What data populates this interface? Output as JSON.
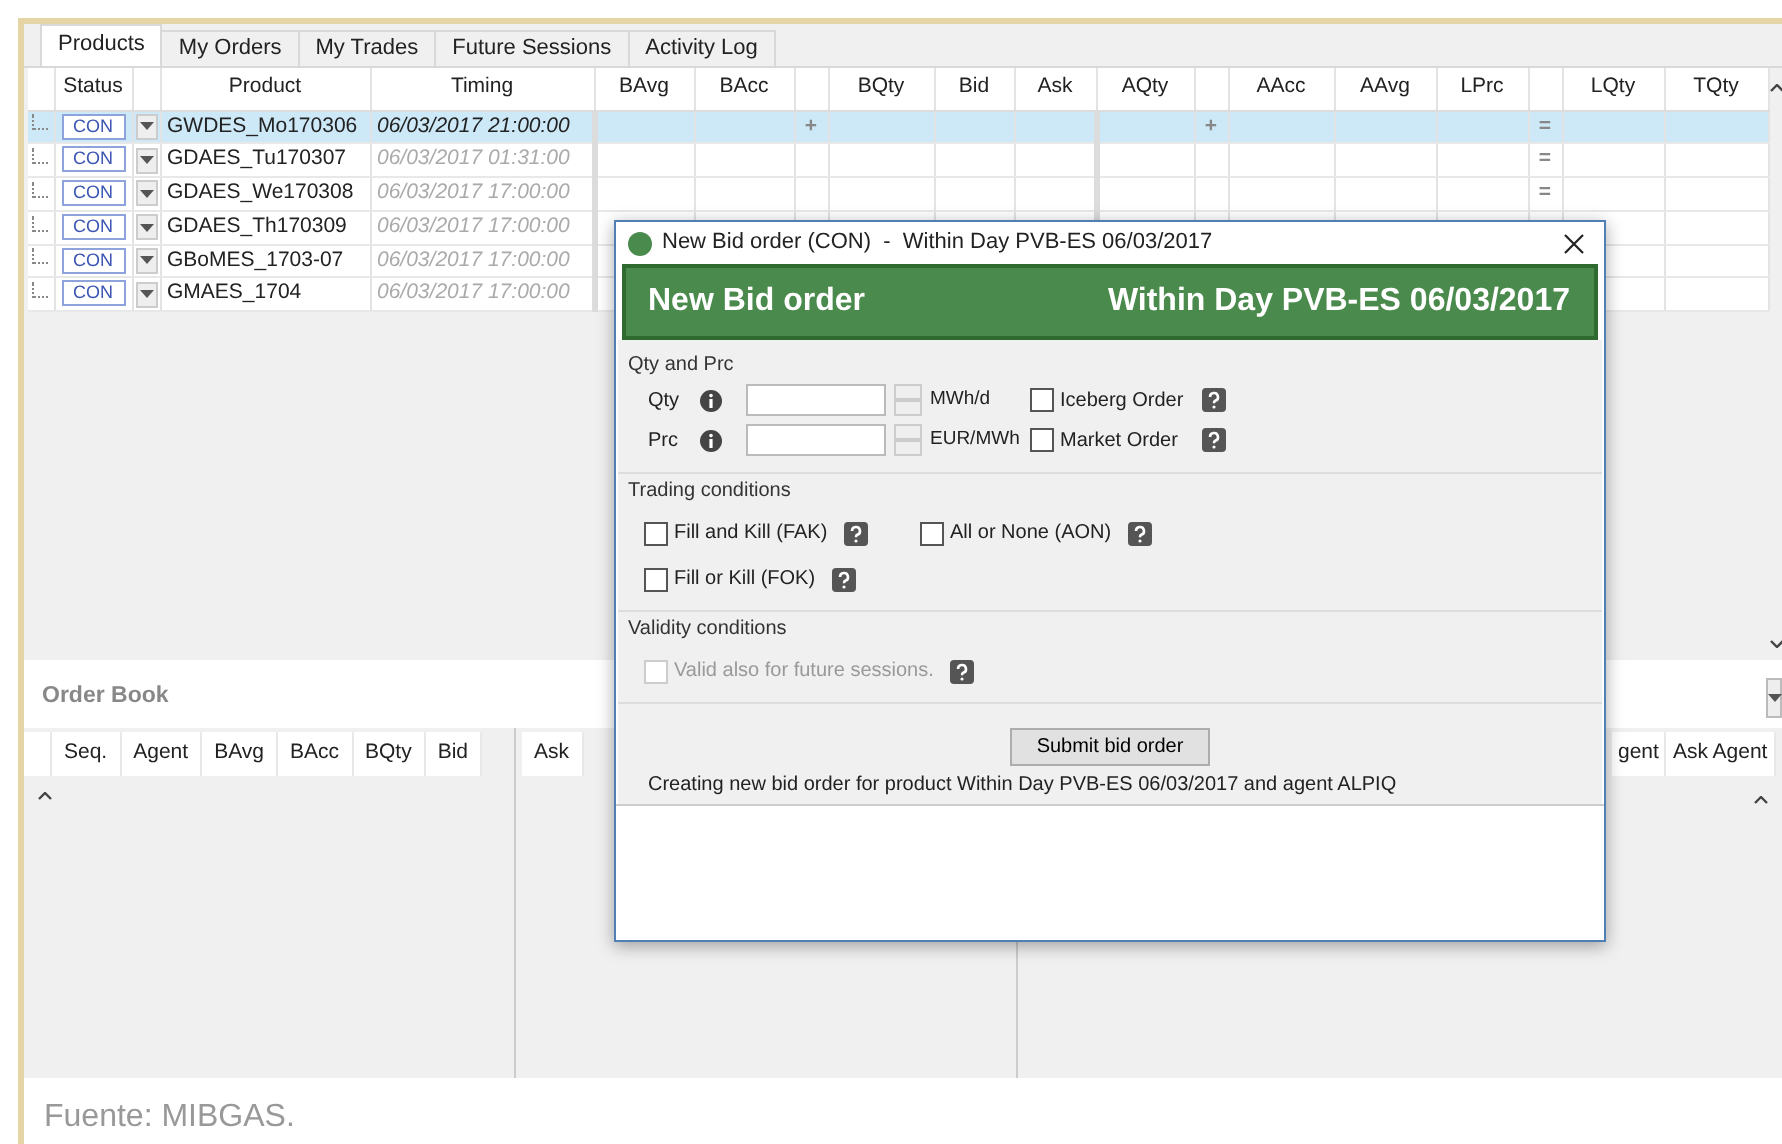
{
  "tabs": [
    {
      "label": "Products",
      "selected": true
    },
    {
      "label": "My Orders",
      "selected": false
    },
    {
      "label": "My Trades",
      "selected": false
    },
    {
      "label": "Future Sessions",
      "selected": false
    },
    {
      "label": "Activity Log",
      "selected": false
    }
  ],
  "products_table": {
    "columns": [
      "Status",
      "Product",
      "Timing",
      "BAvg",
      "BAcc",
      "BQty",
      "Bid",
      "Ask",
      "AQty",
      "AAcc",
      "AAvg",
      "LPrc",
      "LQty",
      "TQty"
    ],
    "rows": [
      {
        "status": "CON",
        "product": "GWDES_Mo170306",
        "timing": "06/03/2017 21:00:00",
        "selected": true,
        "bid_marker": "+",
        "ask_marker": "+",
        "trend_marker": "="
      },
      {
        "status": "CON",
        "product": "GDAES_Tu170307",
        "timing": "06/03/2017 01:31:00",
        "selected": false,
        "trend_marker": "="
      },
      {
        "status": "CON",
        "product": "GDAES_We170308",
        "timing": "06/03/2017 17:00:00",
        "selected": false,
        "trend_marker": "="
      },
      {
        "status": "CON",
        "product": "GDAES_Th170309",
        "timing": "06/03/2017 17:00:00",
        "selected": false
      },
      {
        "status": "CON",
        "product": "GBoMES_1703-07",
        "timing": "06/03/2017 17:00:00",
        "selected": false
      },
      {
        "status": "CON",
        "product": "GMAES_1704",
        "timing": "06/03/2017 17:00:00",
        "selected": false
      }
    ]
  },
  "order_book": {
    "title": "Order Book",
    "bid_columns": [
      "Seq.",
      "Agent",
      "BAvg",
      "BAcc",
      "BQty",
      "Bid"
    ],
    "ask_columns": [
      "Ask"
    ],
    "right_columns": [
      "gent",
      "Ask Agent"
    ]
  },
  "dialog": {
    "title": "New Bid order (CON)  -  Within Day PVB-ES 06/03/2017",
    "banner_left": "New Bid order",
    "banner_right": "Within Day PVB-ES 06/03/2017",
    "groups": [
      {
        "kind": "fields",
        "title": "Qty and Prc",
        "fields": [
          {
            "label": "Qty",
            "unit": "MWh/d",
            "option": {
              "label": "Iceberg Order",
              "checked": false,
              "disabled": false
            }
          },
          {
            "label": "Prc",
            "unit": "EUR/MWh",
            "option": {
              "label": "Market Order",
              "checked": false,
              "disabled": false
            }
          }
        ]
      },
      {
        "kind": "options",
        "title": "Trading conditions",
        "options": [
          {
            "label": "Fill and Kill (FAK)",
            "checked": false,
            "disabled": false
          },
          {
            "label": "All or None (AON)",
            "checked": false,
            "disabled": false
          },
          {
            "label": "Fill or Kill (FOK)",
            "checked": false,
            "disabled": false
          }
        ]
      },
      {
        "kind": "options",
        "title": "Validity conditions",
        "options": [
          {
            "label": "Valid also for future sessions.",
            "checked": false,
            "disabled": true
          }
        ]
      }
    ],
    "submit": "Submit bid order",
    "message": "Creating new bid order for product Within Day PVB-ES 06/03/2017 and agent ALPIQ"
  },
  "caption": "Fuente: MIBGAS."
}
